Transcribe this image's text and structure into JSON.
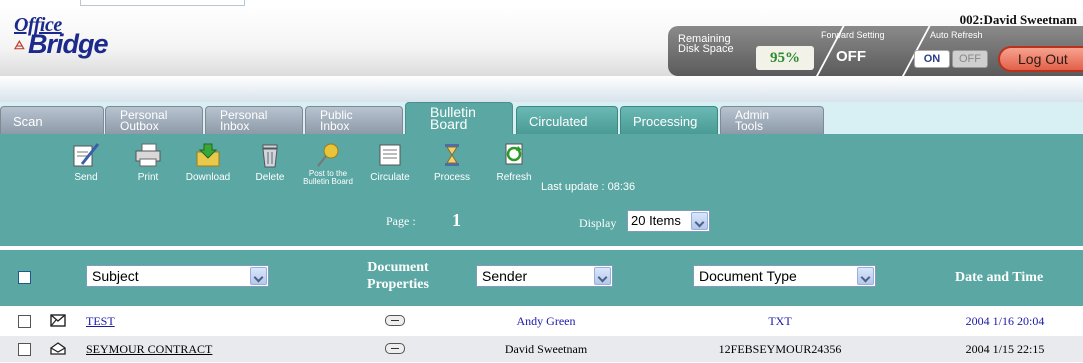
{
  "header": {
    "logo_top": "Office",
    "logo_bottom": "Bridge",
    "user": "002:David Sweetnam",
    "disk_label": "Remaining Disk Space",
    "disk_value": "95%",
    "forward_label": "Forward Setting",
    "forward_value": "OFF",
    "auto_refresh_label": "Auto Refresh",
    "auto_on": "ON",
    "auto_off": "OFF",
    "logout": "Log Out"
  },
  "tabs": [
    {
      "label1": "Scan",
      "label2": ""
    },
    {
      "label1": "Personal",
      "label2": "Outbox"
    },
    {
      "label1": "Personal",
      "label2": "Inbox"
    },
    {
      "label1": "Public",
      "label2": "Inbox"
    },
    {
      "label1": "Bulletin",
      "label2": "Board"
    },
    {
      "label1": "Circulated",
      "label2": ""
    },
    {
      "label1": "Processing",
      "label2": ""
    },
    {
      "label1": "Admin",
      "label2": "Tools"
    }
  ],
  "toolbar": {
    "send": "Send",
    "print": "Print",
    "download": "Download",
    "delete": "Delete",
    "post1": "Post to the",
    "post2": "Bulletin Board",
    "circulate": "Circulate",
    "process": "Process",
    "refresh": "Refresh",
    "last_update_label": "Last update :",
    "last_update_value": "08:36",
    "page_label": "Page :",
    "page_value": "1",
    "display_label": "Display",
    "display_value": "20 Items"
  },
  "columns": {
    "subject": "Subject",
    "doc_props1": "Document",
    "doc_props2": "Properties",
    "sender": "Sender",
    "doc_type": "Document Type",
    "date_time": "Date and Time"
  },
  "rows": [
    {
      "subject": "TEST",
      "sender": "Andy Green",
      "doc_type": "TXT",
      "date": "2004 1/16 20:04"
    },
    {
      "subject": "SEYMOUR CONTRACT",
      "sender": "David Sweetnam",
      "doc_type": "12FEBSEYMOUR24356",
      "date": "2004 1/15 22:15"
    }
  ]
}
